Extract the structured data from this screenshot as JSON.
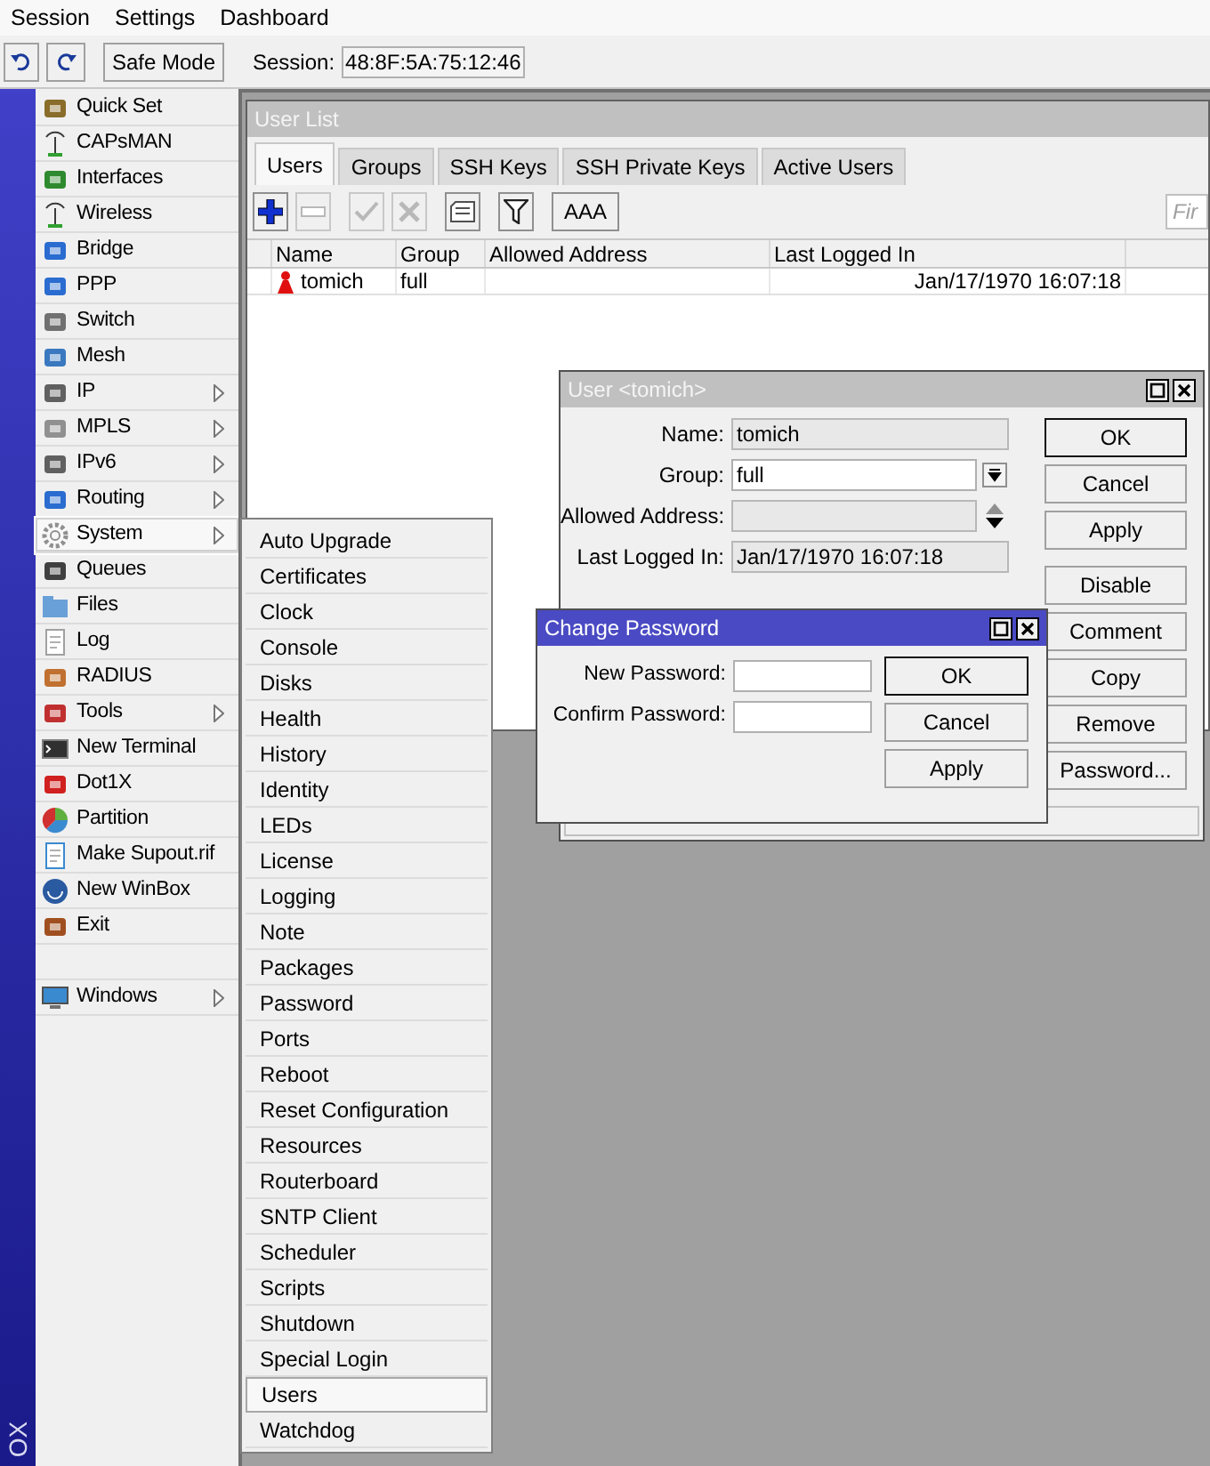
{
  "menu_bar": [
    "Session",
    "Settings",
    "Dashboard"
  ],
  "toolbar": {
    "safe_mode": "Safe Mode",
    "session_label": "Session:",
    "session_value": "48:8F:5A:75:12:46"
  },
  "sidebar": {
    "brand": "OX",
    "items": [
      {
        "label": "Quick Set",
        "submenu": false,
        "selected": false
      },
      {
        "label": "CAPsMAN",
        "submenu": false,
        "selected": false
      },
      {
        "label": "Interfaces",
        "submenu": false,
        "selected": false
      },
      {
        "label": "Wireless",
        "submenu": false,
        "selected": false
      },
      {
        "label": "Bridge",
        "submenu": false,
        "selected": false
      },
      {
        "label": "PPP",
        "submenu": false,
        "selected": false
      },
      {
        "label": "Switch",
        "submenu": false,
        "selected": false
      },
      {
        "label": "Mesh",
        "submenu": false,
        "selected": false
      },
      {
        "label": "IP",
        "submenu": true,
        "selected": false
      },
      {
        "label": "MPLS",
        "submenu": true,
        "selected": false
      },
      {
        "label": "IPv6",
        "submenu": true,
        "selected": false
      },
      {
        "label": "Routing",
        "submenu": true,
        "selected": false
      },
      {
        "label": "System",
        "submenu": true,
        "selected": true
      },
      {
        "label": "Queues",
        "submenu": false,
        "selected": false
      },
      {
        "label": "Files",
        "submenu": false,
        "selected": false
      },
      {
        "label": "Log",
        "submenu": false,
        "selected": false
      },
      {
        "label": "RADIUS",
        "submenu": false,
        "selected": false
      },
      {
        "label": "Tools",
        "submenu": true,
        "selected": false
      },
      {
        "label": "New Terminal",
        "submenu": false,
        "selected": false
      },
      {
        "label": "Dot1X",
        "submenu": false,
        "selected": false
      },
      {
        "label": "Partition",
        "submenu": false,
        "selected": false
      },
      {
        "label": "Make Supout.rif",
        "submenu": false,
        "selected": false
      },
      {
        "label": "New WinBox",
        "submenu": false,
        "selected": false
      },
      {
        "label": "Exit",
        "submenu": false,
        "selected": false
      }
    ],
    "bottom_items": [
      {
        "label": "Windows",
        "submenu": true,
        "selected": false
      }
    ]
  },
  "submenu": {
    "items": [
      {
        "label": "Auto Upgrade",
        "selected": false
      },
      {
        "label": "Certificates",
        "selected": false
      },
      {
        "label": "Clock",
        "selected": false
      },
      {
        "label": "Console",
        "selected": false
      },
      {
        "label": "Disks",
        "selected": false
      },
      {
        "label": "Health",
        "selected": false
      },
      {
        "label": "History",
        "selected": false
      },
      {
        "label": "Identity",
        "selected": false
      },
      {
        "label": "LEDs",
        "selected": false
      },
      {
        "label": "License",
        "selected": false
      },
      {
        "label": "Logging",
        "selected": false
      },
      {
        "label": "Note",
        "selected": false
      },
      {
        "label": "Packages",
        "selected": false
      },
      {
        "label": "Password",
        "selected": false
      },
      {
        "label": "Ports",
        "selected": false
      },
      {
        "label": "Reboot",
        "selected": false
      },
      {
        "label": "Reset Configuration",
        "selected": false
      },
      {
        "label": "Resources",
        "selected": false
      },
      {
        "label": "Routerboard",
        "selected": false
      },
      {
        "label": "SNTP Client",
        "selected": false
      },
      {
        "label": "Scheduler",
        "selected": false
      },
      {
        "label": "Scripts",
        "selected": false
      },
      {
        "label": "Shutdown",
        "selected": false
      },
      {
        "label": "Special Login",
        "selected": false
      },
      {
        "label": "Users",
        "selected": true
      },
      {
        "label": "Watchdog",
        "selected": false
      }
    ]
  },
  "user_list": {
    "title": "User List",
    "tabs": [
      {
        "label": "Users",
        "selected": true
      },
      {
        "label": "Groups",
        "selected": false
      },
      {
        "label": "SSH Keys",
        "selected": false
      },
      {
        "label": "SSH Private Keys",
        "selected": false
      },
      {
        "label": "Active Users",
        "selected": false
      }
    ],
    "tools": [
      {
        "kind": "add",
        "disabled": false
      },
      {
        "kind": "remove",
        "disabled": true
      },
      {
        "kind": "enable",
        "disabled": true
      },
      {
        "kind": "disable",
        "disabled": true
      },
      {
        "kind": "comment",
        "disabled": false
      },
      {
        "kind": "filter",
        "disabled": false
      }
    ],
    "aaa_button": "AAA",
    "find_placeholder": "Fir",
    "columns": [
      "Name",
      "Group",
      "Allowed Address",
      "Last Logged In"
    ],
    "rows": [
      {
        "name": "tomich",
        "group": "full",
        "last_logged_in": "Jan/17/1970 16:07:18"
      }
    ]
  },
  "user_dialog": {
    "title": "User <tomich>",
    "fields": [
      {
        "label": "Name:",
        "value": "tomich",
        "kind": "readonly"
      },
      {
        "label": "Group:",
        "value": "full",
        "kind": "dropdown"
      },
      {
        "label": "Allowed Address:",
        "kind": "multi"
      },
      {
        "label": "Last Logged In:",
        "value": "Jan/17/1970 16:07:18",
        "kind": "readonly"
      }
    ],
    "buttons": [
      {
        "label": "OK",
        "default": true
      },
      {
        "label": "Cancel",
        "default": false
      },
      {
        "label": "Apply",
        "default": false
      },
      {
        "label": "Disable",
        "default": false
      },
      {
        "label": "Comment",
        "default": false
      },
      {
        "label": "Copy",
        "default": false
      },
      {
        "label": "Remove",
        "default": false
      },
      {
        "label": "Password...",
        "default": false
      }
    ]
  },
  "password_dialog": {
    "title": "Change Password",
    "fields": [
      {
        "label": "New Password:"
      },
      {
        "label": "Confirm Password:"
      }
    ],
    "buttons": [
      {
        "label": "OK",
        "default": true
      },
      {
        "label": "Cancel",
        "default": false
      },
      {
        "label": "Apply",
        "default": false
      }
    ]
  }
}
